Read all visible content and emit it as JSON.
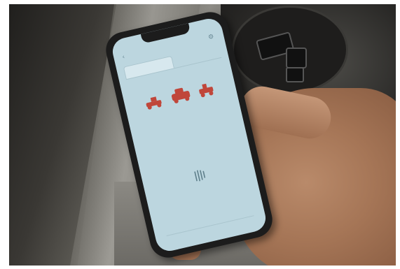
{
  "scene": {
    "description_icons": [
      "phone",
      "hand",
      "vehicle-console"
    ]
  },
  "app": {
    "brand": "",
    "tabs": [
      {
        "label": "",
        "active": true
      },
      {
        "label": "",
        "active": false
      }
    ],
    "message_lines": [
      "",
      "",
      ""
    ],
    "colors": {
      "screen": "#bcd6df",
      "accent": "#c0463a",
      "text": "#5a7d8a"
    }
  }
}
